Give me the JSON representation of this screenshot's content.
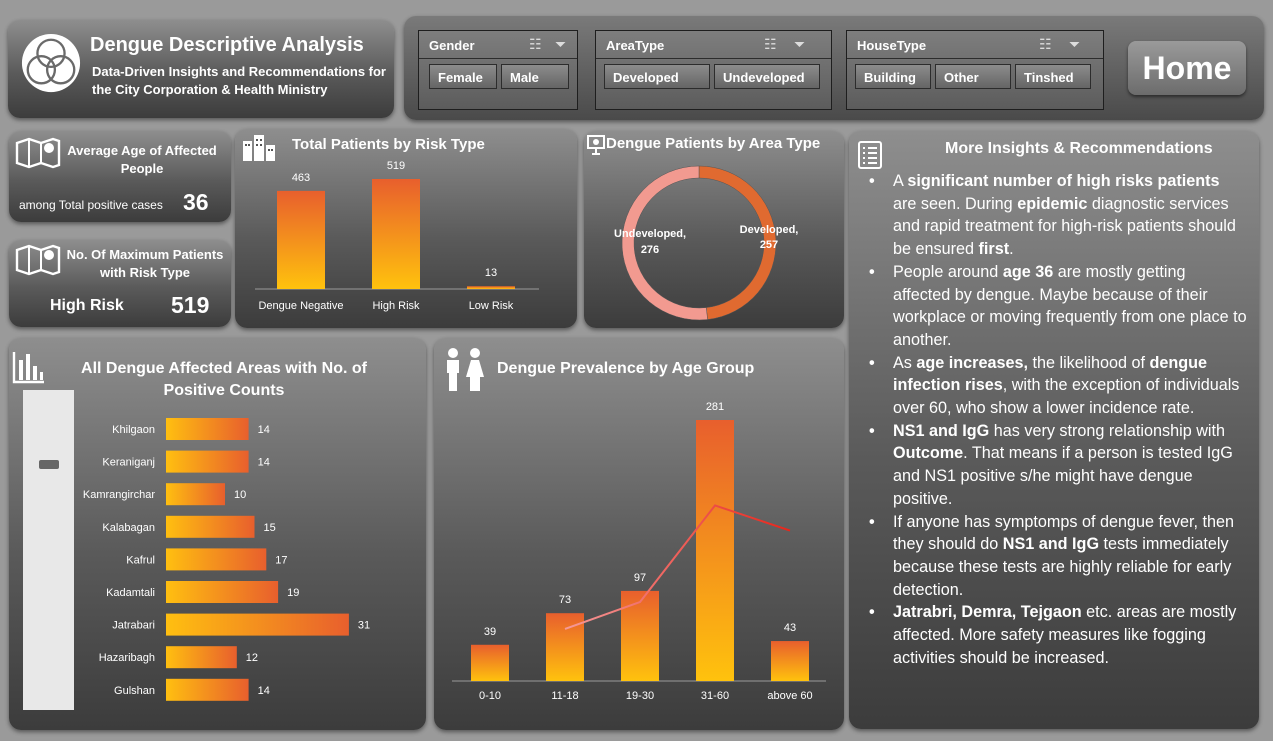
{
  "header": {
    "title": "Dengue Descriptive Analysis",
    "subtitle": "Data-Driven Insights and Recommendations for the City Corporation & Health Ministry"
  },
  "slicers": [
    {
      "label": "Gender",
      "options": [
        "Female",
        "Male"
      ]
    },
    {
      "label": "AreaType",
      "options": [
        "Developed",
        "Undeveloped"
      ]
    },
    {
      "label": "HouseType",
      "options": [
        "Building",
        "Other",
        "Tinshed"
      ]
    }
  ],
  "home_label": "Home",
  "kpi_avg_age": {
    "title": "Average Age of Affected People",
    "caption": "among Total positive cases",
    "value": "36"
  },
  "kpi_max": {
    "title": "No. Of Maximum Patients with Risk Type",
    "label": "High Risk",
    "value": "519"
  },
  "risk_chart": {
    "title": "Total Patients by Risk Type"
  },
  "area_type_chart": {
    "title": "Dengue Patients by Area Type"
  },
  "areas_chart": {
    "title": "All Dengue Affected Areas with No. of Positive Counts"
  },
  "age_chart": {
    "title": "Dengue Prevalence by Age Group"
  },
  "insights": {
    "title": "More Insights & Recommendations",
    "items": [
      [
        "A ",
        {
          "b": "significant number of high risks patients"
        },
        " are seen. During ",
        {
          "b": "epidemic"
        },
        " diagnostic services and rapid treatment for high-risk patients should be ensured ",
        {
          "b": "first"
        },
        "."
      ],
      [
        "People around ",
        {
          "b": "age 36"
        },
        " are mostly getting affected by dengue. Maybe because of their workplace or moving frequently from one place to another."
      ],
      [
        "As ",
        {
          "b": "age increases,"
        },
        " the likelihood of ",
        {
          "b": "dengue infection rises"
        },
        ", with the exception of individuals over 60, who show a lower incidence rate."
      ],
      [
        {
          "b": "NS1 and IgG"
        },
        " has very strong relationship with ",
        {
          "b": "Outcome"
        },
        ". That means if a person is tested IgG and NS1 positive s/he might have dengue positive."
      ],
      [
        "If anyone has symptomps of dengue fever, then they should do ",
        {
          "b": "NS1 and IgG"
        },
        " tests immediately because these tests are highly reliable for early detection."
      ],
      [
        {
          "b": "Jatrabri, Demra, Tejgaon"
        },
        " etc. areas are mostly affected. More safety measures like fogging activities should be increased."
      ]
    ]
  },
  "chart_data": [
    {
      "type": "bar",
      "id": "risk",
      "categories": [
        "Dengue Negative",
        "High Risk",
        "Low Risk"
      ],
      "values": [
        463,
        519,
        13
      ]
    },
    {
      "type": "pie",
      "id": "area_type",
      "donut": true,
      "labels": [
        "Developed",
        "Undeveloped"
      ],
      "values": [
        257,
        276
      ],
      "colors": [
        "#e06a30",
        "#f29a90"
      ]
    },
    {
      "type": "bar",
      "id": "areas",
      "orientation": "horizontal",
      "categories": [
        "Khilgaon",
        "Keraniganj",
        "Kamrangirchar",
        "Kalabagan",
        "Kafrul",
        "Kadamtali",
        "Jatrabari",
        "Hazaribagh",
        "Gulshan"
      ],
      "values": [
        14,
        14,
        10,
        15,
        17,
        19,
        31,
        12,
        14
      ]
    },
    {
      "type": "bar",
      "id": "age",
      "categories": [
        "0-10",
        "11-18",
        "19-30",
        "31-60",
        "above 60"
      ],
      "values": [
        39,
        73,
        97,
        281,
        43
      ],
      "trend_line": true
    }
  ]
}
